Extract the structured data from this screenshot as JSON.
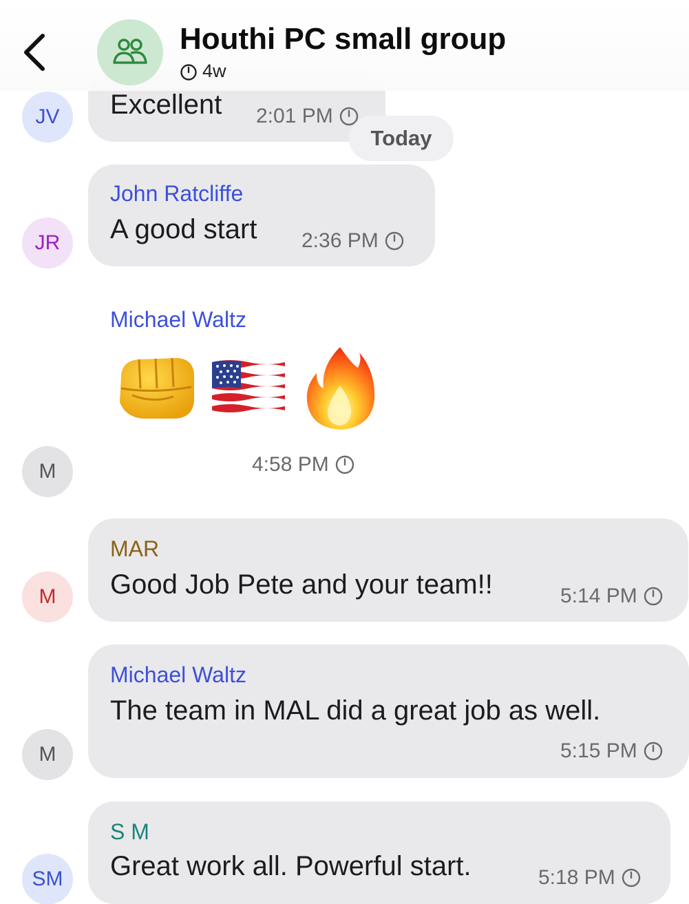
{
  "header": {
    "title": "Houthi PC small group",
    "timer": "4w",
    "avatar_icon": "people-icon",
    "back_icon": "chevron-left-icon"
  },
  "date_separator": "Today",
  "messages": [
    {
      "avatar": "JV",
      "sender": "",
      "text": "Excellent",
      "time": "2:01 PM",
      "status_icon": "timer-icon"
    },
    {
      "avatar": "JR",
      "sender": "John Ratcliffe",
      "text": "A good start",
      "time": "2:36 PM",
      "status_icon": "timer-icon"
    },
    {
      "avatar": "M",
      "sender": "Michael Waltz",
      "emojis": [
        "oncoming-fist-emoji",
        "us-flag-emoji",
        "fire-emoji"
      ],
      "time": "4:58 PM",
      "status_icon": "timer-icon"
    },
    {
      "avatar": "M",
      "sender": "MAR",
      "text": "Good Job Pete and your team!!",
      "time": "5:14 PM",
      "status_icon": "timer-icon"
    },
    {
      "avatar": "M",
      "sender": "Michael Waltz",
      "text": "The team in MAL did a great job  as well.",
      "time": "5:15 PM",
      "status_icon": "timer-icon"
    },
    {
      "avatar": "SM",
      "sender": "S M",
      "text": "Great work all. Powerful start.",
      "time": "5:18 PM",
      "status_icon": "timer-icon"
    }
  ],
  "colors": {
    "bubble": "#e9e9eb",
    "sender_blue": "#3c4fdc",
    "sender_mar": "#8a6214",
    "sender_sm": "#1a8579",
    "group_avatar_bg": "#cde8d1"
  }
}
